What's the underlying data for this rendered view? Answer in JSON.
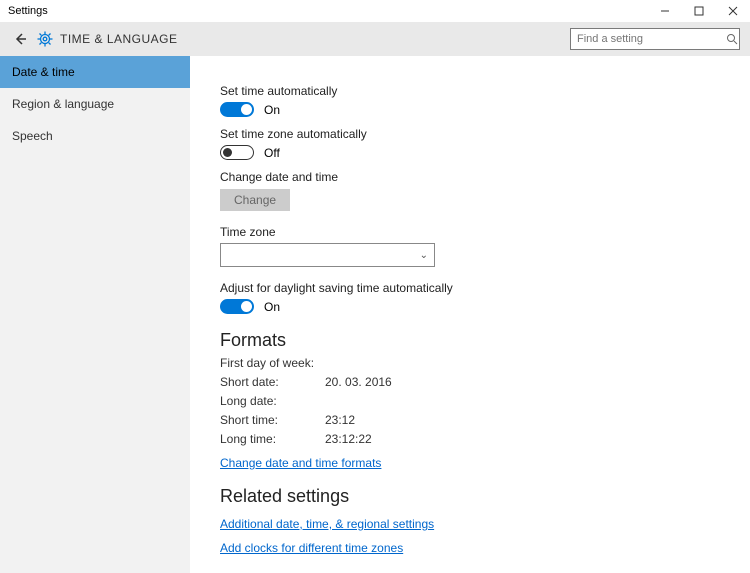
{
  "window": {
    "title": "Settings"
  },
  "header": {
    "page_title": "TIME & LANGUAGE",
    "search_placeholder": "Find a setting"
  },
  "sidebar": {
    "items": [
      {
        "label": "Date & time",
        "active": true
      },
      {
        "label": "Region & language",
        "active": false
      },
      {
        "label": "Speech",
        "active": false
      }
    ]
  },
  "main": {
    "set_time_auto": {
      "label": "Set time automatically",
      "state": "On"
    },
    "set_tz_auto": {
      "label": "Set time zone automatically",
      "state": "Off"
    },
    "change_dt": {
      "label": "Change date and time",
      "button": "Change"
    },
    "tz": {
      "label": "Time zone"
    },
    "dst": {
      "label": "Adjust for daylight saving time automatically",
      "state": "On"
    },
    "formats": {
      "heading": "Formats",
      "rows": [
        {
          "k": "First day of week:",
          "v": ""
        },
        {
          "k": "Short date:",
          "v": "20. 03. 2016"
        },
        {
          "k": "Long date:",
          "v": ""
        },
        {
          "k": "Short time:",
          "v": "23:12"
        },
        {
          "k": "Long time:",
          "v": "23:12:22"
        }
      ],
      "link": "Change date and time formats"
    },
    "related": {
      "heading": "Related settings",
      "links": [
        "Additional date, time, & regional settings",
        "Add clocks for different time zones"
      ]
    }
  }
}
